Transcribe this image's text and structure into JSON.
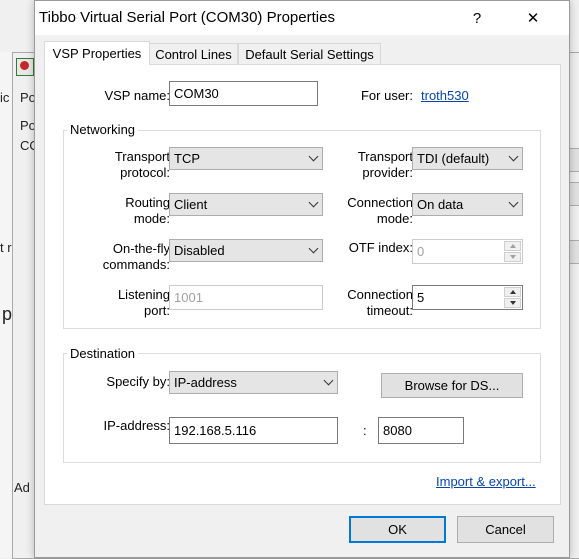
{
  "background_window": {
    "text_fragments": [
      "ic",
      "Po",
      "Po",
      "CO",
      "t r",
      "p",
      "Ad"
    ]
  },
  "dialog": {
    "title": "Tibbo Virtual Serial Port (COM30) Properties",
    "help_glyph": "?",
    "close_glyph": "✕"
  },
  "tabs": [
    {
      "label": "VSP Properties",
      "active": true
    },
    {
      "label": "Control Lines",
      "active": false
    },
    {
      "label": "Default Serial Settings",
      "active": false
    }
  ],
  "vsp": {
    "name_label": "VSP name:",
    "name_value": "COM30",
    "for_user_label": "For user:",
    "for_user_link": "troth530"
  },
  "networking": {
    "title": "Networking",
    "transport_protocol": {
      "label_line1": "Transport",
      "label_line2": "protocol:",
      "value": "TCP"
    },
    "transport_provider": {
      "label_line1": "Transport",
      "label_line2": "provider:",
      "value": "TDI (default)"
    },
    "routing_mode": {
      "label_line1": "Routing",
      "label_line2": "mode:",
      "value": "Client"
    },
    "connection_mode": {
      "label_line1": "Connection",
      "label_line2": "mode:",
      "value": "On data"
    },
    "otf_commands": {
      "label_line1": "On-the-fly",
      "label_line2": "commands:",
      "value": "Disabled"
    },
    "otf_index": {
      "label": "OTF index:",
      "value": "0"
    },
    "listening_port": {
      "label_line1": "Listening",
      "label_line2": "port:",
      "value": "1001"
    },
    "connection_timeout": {
      "label_line1": "Connection",
      "label_line2": "timeout:",
      "value": "5"
    }
  },
  "destination": {
    "title": "Destination",
    "specify_by_label": "Specify by:",
    "specify_by_value": "IP-address",
    "browse_button": "Browse for DS...",
    "ip_label": "IP-address:",
    "ip_value": "192.168.5.116",
    "separator": ":",
    "port_value": "8080"
  },
  "import_export_link": "Import & export...",
  "buttons": {
    "ok": "OK",
    "cancel": "Cancel"
  },
  "colors": {
    "link": "#0645ad",
    "default_button_border": "#0078d7"
  }
}
